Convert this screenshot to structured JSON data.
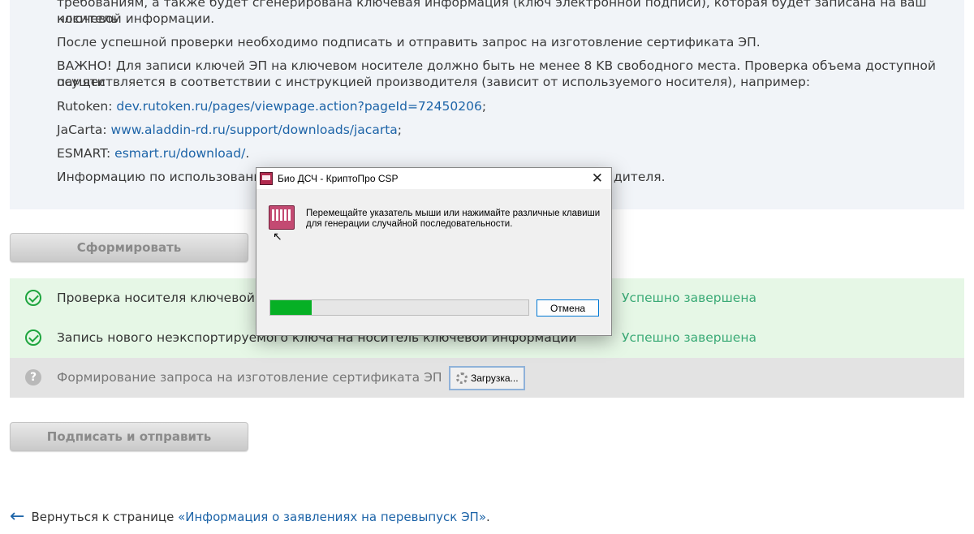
{
  "info": {
    "top_line_1": "требованиям, а также будет сгенерирована ключевая информация (ключ электронной подписи), которая будет записана на ваш носитель",
    "top_line_2": "ключевой информации.",
    "para_sign": "После успешной проверки необходимо подписать и отправить запрос на изготовление сертификата ЭП.",
    "para_important_1": "ВАЖНО! Для записи ключей ЭП на ключевом носителе должно быть не менее 8 KB свободного места. Проверка объема доступной памяти",
    "para_important_2": "осуществляется в соответствии с инструкцией производителя (зависит от используемого носителя), например:",
    "rutoken_prefix": "Rutoken: ",
    "rutoken_link": "dev.rutoken.ru/pages/viewpage.action?pageId=72450206",
    "jacarta_prefix": "JaCarta: ",
    "jacarta_link": "www.aladdin-rd.ru/support/downloads/jacarta",
    "esmart_prefix": "ESMART: ",
    "esmart_link": "esmart.ru/download/",
    "usage_left": "Информацию по использовани",
    "usage_right": "дителя."
  },
  "buttons": {
    "form": "Сформировать",
    "sign_send": "Подписать и отправить"
  },
  "steps": [
    {
      "label": "Проверка носителя ключевой инфор",
      "status": "Успешно завершена"
    },
    {
      "label": "Запись нового неэкспортируемого ключа на носитель ключевой информации",
      "status": "Успешно завершена"
    },
    {
      "label": "Формирование запроса на изготовление сертификата ЭП",
      "status": "",
      "loading": "Загрузка..."
    }
  ],
  "back": {
    "prefix": "Вернуться к странице ",
    "link": "«Информация о заявлениях на перевыпуск ЭП»",
    "suffix": "."
  },
  "dialog": {
    "title": "Био ДСЧ - КриптоПро CSP",
    "message_1": "Перемещайте указатель мыши или нажимайте различные клавиши",
    "message_2": "для генерации случайной последовательности.",
    "cancel": "Отмена",
    "progress": 0.16
  },
  "colors": {
    "link": "#1d64a8",
    "success": "#3aaa76",
    "progress_fill": "#06b025"
  }
}
